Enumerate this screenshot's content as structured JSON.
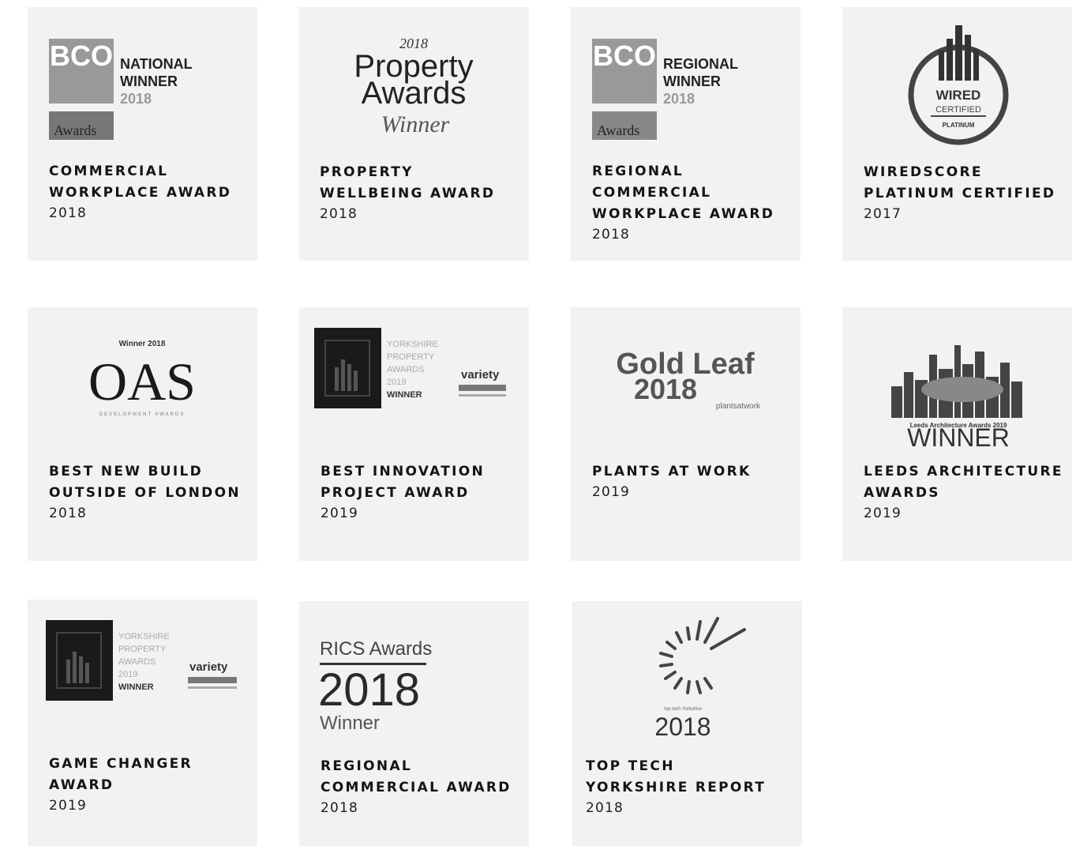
{
  "awards": [
    {
      "logo": {
        "badge": "BCO",
        "line1": "NATIONAL",
        "line2": "WINNER",
        "line3": "2018",
        "footer": "Awards"
      },
      "title": "COMMERCIAL\nWORKPLACE AWARD",
      "year": "2018"
    },
    {
      "logo": {
        "top": "2018",
        "line1": "Property",
        "line2": "Awards",
        "script": "Winner"
      },
      "title": "PROPERTY\nWELLBEING AWARD",
      "year": "2018"
    },
    {
      "logo": {
        "badge": "BCO",
        "line1": "REGIONAL",
        "line2": "WINNER",
        "line3": "2018",
        "footer": "Awards"
      },
      "title": "REGIONAL\nCOMMERCIAL\nWORKPLACE AWARD",
      "year": "2018"
    },
    {
      "logo": {
        "line1": "WIRED",
        "line2": "CERTIFIED",
        "line3": "PLATINUM"
      },
      "title": "WIREDSCORE\nPLATINUM CERTIFIED",
      "year": "2017"
    },
    {
      "logo": {
        "top": "Winner 2018",
        "main": "OAS",
        "bottom": "DEVELOPMENT AWARDS"
      },
      "title": "BEST NEW BUILD\nOUTSIDE OF LONDON",
      "year": "2018"
    },
    {
      "logo": {
        "lines": [
          "YORKSHIRE",
          "PROPERTY",
          "AWARDS",
          "2019",
          "WINNER"
        ],
        "sponsor": "variety"
      },
      "title": "BEST INNOVATION\nPROJECT AWARD",
      "year": "2019"
    },
    {
      "logo": {
        "line1": "Gold Leaf",
        "line2": "2018",
        "small": "plantsatwork"
      },
      "title": "PLANTS AT WORK",
      "year": "2019"
    },
    {
      "logo": {
        "caption": "Leeds Architecture Awards 2019",
        "main": "WINNER"
      },
      "title": "LEEDS ARCHITECTURE\nAWARDS",
      "year": "2019"
    },
    {
      "logo": {
        "lines": [
          "YORKSHIRE",
          "PROPERTY",
          "AWARDS",
          "2019",
          "WINNER"
        ],
        "sponsor": "variety"
      },
      "title": "GAME CHANGER\nAWARD",
      "year": "2019"
    },
    {
      "logo": {
        "line1": "RICS Awards",
        "line2": "2018",
        "line3": "Winner"
      },
      "title": "REGIONAL\nCOMMERCIAL AWARD",
      "year": "2018"
    },
    {
      "logo": {
        "small": "top tech Yorkshire",
        "year": "2018"
      },
      "title": "TOP TECH\nYORKSHIRE REPORT",
      "year": "2018"
    }
  ]
}
